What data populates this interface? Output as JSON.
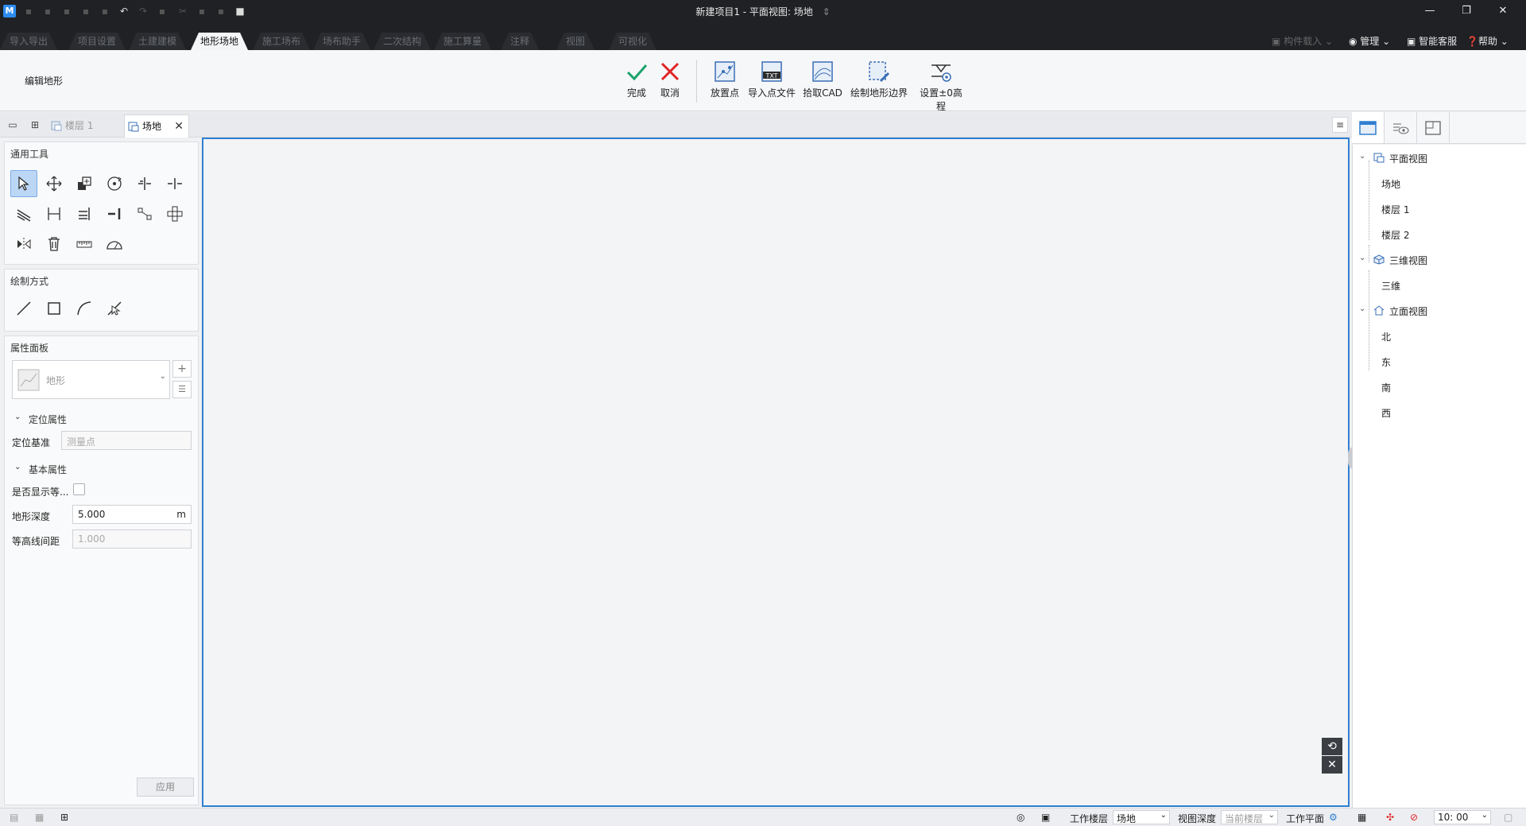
{
  "title": {
    "text": "新建项目1 - 平面视图: 场地",
    "app_icon": "M"
  },
  "tabs": {
    "items": [
      {
        "label": "导入导出"
      },
      {
        "label": "项目设置"
      },
      {
        "label": "土建建模"
      },
      {
        "label": "地形场地"
      },
      {
        "label": "施工场布"
      },
      {
        "label": "场布助手"
      },
      {
        "label": "二次结构"
      },
      {
        "label": "施工算量"
      },
      {
        "label": "注释"
      },
      {
        "label": "视图"
      },
      {
        "label": "可视化"
      }
    ],
    "active": "地形场地",
    "right": {
      "component_load": "构件载入",
      "manage": "管理",
      "support": "智能客服",
      "help": "帮助"
    }
  },
  "ribbon": {
    "mode_label": "编辑地形",
    "finish": "完成",
    "cancel": "取消",
    "place_point": "放置点",
    "import_points": "导入点文件",
    "pick_cad": "拾取CAD",
    "draw_boundary": "绘制地形边界",
    "set_zero": "设置±0高程",
    "txt_badge": "TXT"
  },
  "doc_tabs": {
    "floor1": "楼层 1",
    "site": "场地"
  },
  "left": {
    "general_tools_title": "通用工具",
    "draw_mode_title": "绘制方式",
    "props_title": "属性面板",
    "type_name": "地形",
    "locate_group": "定位属性",
    "locate_base_label": "定位基准",
    "locate_base_placeholder": "测量点",
    "basic_group": "基本属性",
    "show_contour_label": "是否显示等...",
    "terrain_depth_label": "地形深度",
    "terrain_depth_value": "5.000",
    "terrain_depth_unit": "m",
    "contour_interval_label": "等高线间距",
    "contour_interval_value": "1.000",
    "apply_label": "应用"
  },
  "tree": {
    "plan": "平面视图",
    "plan_children": [
      "场地",
      "楼层 1",
      "楼层 2"
    ],
    "threed": "三维视图",
    "threed_children": [
      "三维"
    ],
    "elev": "立面视图",
    "elev_children": [
      "北",
      "东",
      "南",
      "西"
    ]
  },
  "status": {
    "work_floor_label": "工作楼层",
    "work_floor_value": "场地",
    "view_depth_label": "视图深度",
    "view_depth_value": "当前楼层",
    "work_plane_label": "工作平面",
    "time": "10: 00"
  },
  "colors": {
    "accent": "#2f7fd1",
    "finish_green": "#1aa36b",
    "cancel_red": "#e02424",
    "titlebar": "#1f2124"
  }
}
